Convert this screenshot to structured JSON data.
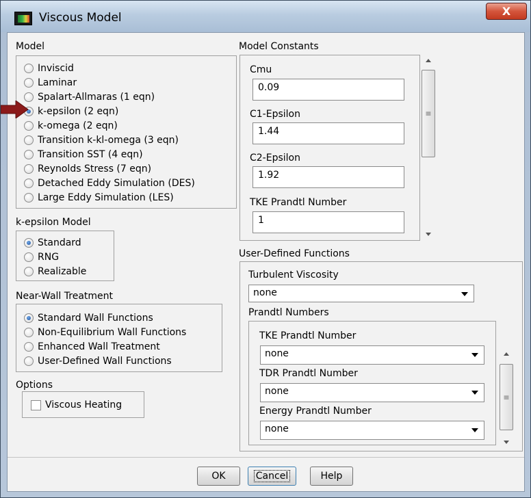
{
  "window": {
    "title": "Viscous Model",
    "close_glyph": "X"
  },
  "model": {
    "label": "Model",
    "options": [
      {
        "label": "Inviscid",
        "checked": false
      },
      {
        "label": "Laminar",
        "checked": false
      },
      {
        "label": "Spalart-Allmaras (1 eqn)",
        "checked": false
      },
      {
        "label": "k-epsilon (2 eqn)",
        "checked": true
      },
      {
        "label": "k-omega (2 eqn)",
        "checked": false
      },
      {
        "label": "Transition k-kl-omega (3 eqn)",
        "checked": false
      },
      {
        "label": "Transition SST (4 eqn)",
        "checked": false
      },
      {
        "label": "Reynolds Stress (7 eqn)",
        "checked": false
      },
      {
        "label": "Detached Eddy Simulation (DES)",
        "checked": false
      },
      {
        "label": "Large Eddy Simulation (LES)",
        "checked": false
      }
    ]
  },
  "kepsilon": {
    "label": "k-epsilon Model",
    "options": [
      {
        "label": "Standard",
        "checked": true
      },
      {
        "label": "RNG",
        "checked": false
      },
      {
        "label": "Realizable",
        "checked": false
      }
    ]
  },
  "nearwall": {
    "label": "Near-Wall Treatment",
    "options": [
      {
        "label": "Standard Wall Functions",
        "checked": true
      },
      {
        "label": "Non-Equilibrium Wall Functions",
        "checked": false
      },
      {
        "label": "Enhanced Wall Treatment",
        "checked": false
      },
      {
        "label": "User-Defined Wall Functions",
        "checked": false
      }
    ]
  },
  "options": {
    "label": "Options",
    "viscous_heating": {
      "label": "Viscous Heating",
      "checked": false
    }
  },
  "constants": {
    "label": "Model Constants",
    "fields": [
      {
        "label": "Cmu",
        "value": "0.09"
      },
      {
        "label": "C1-Epsilon",
        "value": "1.44"
      },
      {
        "label": "C2-Epsilon",
        "value": "1.92"
      },
      {
        "label": "TKE Prandtl Number",
        "value": "1"
      }
    ]
  },
  "udf": {
    "label": "User-Defined Functions",
    "turbulent_viscosity": {
      "label": "Turbulent Viscosity",
      "value": "none"
    },
    "prandtl": {
      "label": "Prandtl Numbers",
      "fields": [
        {
          "label": "TKE Prandtl Number",
          "value": "none"
        },
        {
          "label": "TDR Prandtl Number",
          "value": "none"
        },
        {
          "label": "Energy Prandtl Number",
          "value": "none"
        }
      ]
    }
  },
  "buttons": {
    "ok": "OK",
    "cancel": "Cancel",
    "help": "Help"
  },
  "colors": {
    "arrow_marker": "#8b1a1a"
  }
}
